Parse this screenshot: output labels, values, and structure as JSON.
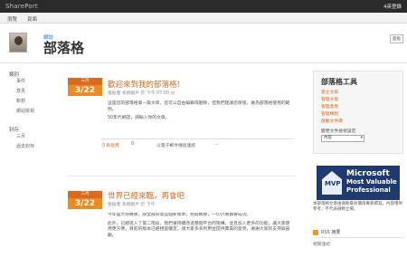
{
  "topbar": {
    "brand": "SharePort",
    "signin": "4英登錄"
  },
  "nav": {
    "item1": "瀏覽",
    "item2": "頁面"
  },
  "header": {
    "crumb": "網誌",
    "title": "部落格",
    "button": "面板"
  },
  "leftnav": {
    "sections": [
      {
        "heading": "類別",
        "items": [
          "事件",
          "意見",
          "新想",
          "網站檢視"
        ]
      },
      {
        "heading": "封存",
        "items": [
          "三月",
          "過去封存"
        ]
      }
    ]
  },
  "posts": [
    {
      "month": "三月",
      "day": "3/22",
      "title": "歡迎來到我的部落格!",
      "meta": "張貼者 系統帳戶 於 下午 07:00 分",
      "paragraphs": [
        "這是您的部落格第一篇文章，您可以自由編輯或刪除，但我們建議您保留，做為部落格使用的範例。",
        "50年代網誌，請輸入你的文章。"
      ],
      "footer": {
        "comments": "0 則意見",
        "links": "0",
        "email": "以電子郵件傳送連結",
        "more": "..."
      }
    },
    {
      "month": "三月",
      "day": "3/22",
      "title": "世界已經來臨，再會吧",
      "meta": "張貼者 系統帳戶 於 下午",
      "paragraphs": [
        "今年是大好機會，請全部同意這個新版本，把握機會，一切計畫都會成功。",
        "此外，已經進入了第二階段，我們會持續改進整個平台的架構，並且加入更多的功能，讓大家使用更方便。目前的版本已經相當穩定，請大家多多利用並提供寶貴的意見，謝謝大家的支持與鼓勵。"
      ]
    }
  ],
  "widget": {
    "title": "部落格工具",
    "links": [
      "建立文章",
      "管理文章",
      "管理意見",
      "管理類別",
      "啟動文件庫"
    ],
    "select_label": "變更文件檢視設定",
    "select_value": "內容"
  },
  "mvp": {
    "badge": "MVP",
    "line1": "Microsoft",
    "line2": "Most Valuable",
    "line3": "Professional",
    "note": "本部落格文章由微軟最有價值專家撰寫，內容僅供參考，不代表微軟立場。"
  },
  "rss": {
    "label": "RSS 摘要",
    "extra": "相關連結"
  }
}
